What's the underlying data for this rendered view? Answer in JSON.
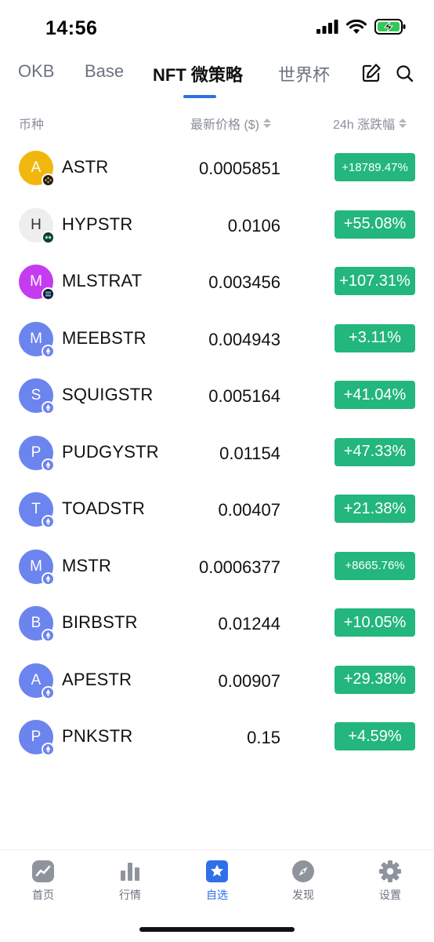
{
  "status": {
    "time": "14:56"
  },
  "tabs": [
    {
      "label": "OKB",
      "active": false
    },
    {
      "label": "Base",
      "active": false
    },
    {
      "label": "NFT 微策略",
      "active": true
    },
    {
      "label": "世界杯",
      "active": false
    }
  ],
  "header": {
    "col_coin": "币种",
    "col_price": "最新价格 ($)",
    "col_change": "24h 涨跌幅"
  },
  "rows": [
    {
      "symbol": "ASTR",
      "letter": "A",
      "price": "0.0005851",
      "change": "+18789.47%",
      "avatar_color": "#f2b70f",
      "chain": "bnb-chain-icon"
    },
    {
      "symbol": "HYPSTR",
      "letter": "H",
      "price": "0.0106",
      "change": "+55.08%",
      "avatar_color": "#eeeeee",
      "chain": "hyperliquid-icon"
    },
    {
      "symbol": "MLSTRAT",
      "letter": "M",
      "price": "0.003456",
      "change": "+107.31%",
      "avatar_color": "#c53cf0",
      "chain": "solana-icon"
    },
    {
      "symbol": "MEEBSTR",
      "letter": "M",
      "price": "0.004943",
      "change": "+3.11%",
      "avatar_color": "#6c84ee",
      "chain": "ethereum-icon"
    },
    {
      "symbol": "SQUIGSTR",
      "letter": "S",
      "price": "0.005164",
      "change": "+41.04%",
      "avatar_color": "#6c84ee",
      "chain": "ethereum-icon"
    },
    {
      "symbol": "PUDGYSTR",
      "letter": "P",
      "price": "0.01154",
      "change": "+47.33%",
      "avatar_color": "#6c84ee",
      "chain": "ethereum-icon"
    },
    {
      "symbol": "TOADSTR",
      "letter": "T",
      "price": "0.00407",
      "change": "+21.38%",
      "avatar_color": "#6c84ee",
      "chain": "ethereum-icon"
    },
    {
      "symbol": "MSTR",
      "letter": "M",
      "price": "0.0006377",
      "change": "+8665.76%",
      "avatar_color": "#6c84ee",
      "chain": "ethereum-icon"
    },
    {
      "symbol": "BIRBSTR",
      "letter": "B",
      "price": "0.01244",
      "change": "+10.05%",
      "avatar_color": "#6c84ee",
      "chain": "ethereum-icon"
    },
    {
      "symbol": "APESTR",
      "letter": "A",
      "price": "0.00907",
      "change": "+29.38%",
      "avatar_color": "#6c84ee",
      "chain": "ethereum-icon"
    },
    {
      "symbol": "PNKSTR",
      "letter": "P",
      "price": "0.15",
      "change": "+4.59%",
      "avatar_color": "#6c84ee",
      "chain": "ethereum-icon"
    }
  ],
  "nav": [
    {
      "label": "首页",
      "icon": "home-chart-icon",
      "active": false
    },
    {
      "label": "行情",
      "icon": "market-bars-icon",
      "active": false
    },
    {
      "label": "自选",
      "icon": "star-icon",
      "active": true
    },
    {
      "label": "发现",
      "icon": "compass-icon",
      "active": false
    },
    {
      "label": "设置",
      "icon": "settings-gear-icon",
      "active": false
    }
  ],
  "colors": {
    "accent": "#2f6fe8",
    "positive": "#23b67d",
    "muted": "#8a8f99"
  }
}
